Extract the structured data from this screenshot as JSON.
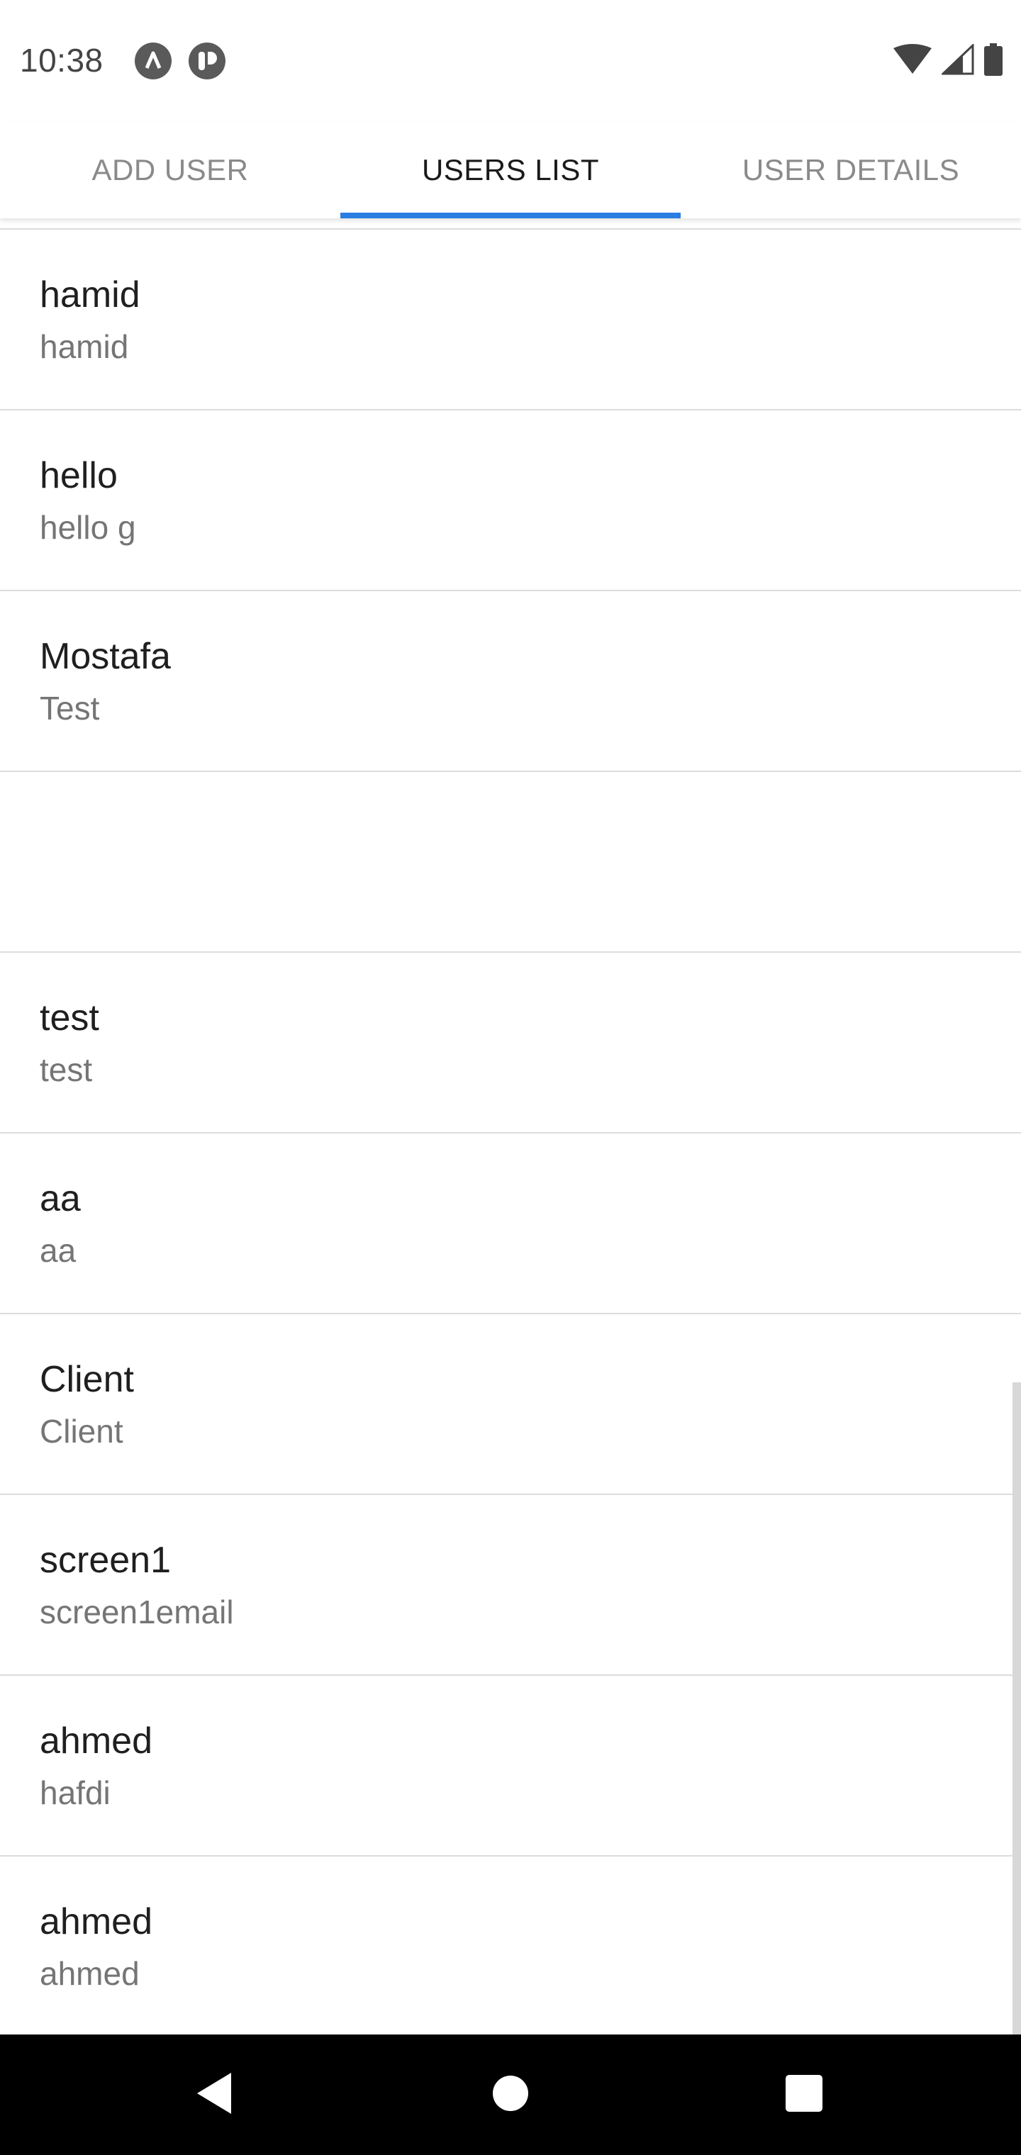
{
  "status_bar": {
    "time": "10:38",
    "icons": [
      "notification-a-icon",
      "notification-b-icon",
      "wifi-icon",
      "signal-icon",
      "battery-icon"
    ]
  },
  "tabs": [
    {
      "label": "ADD USER",
      "active": false
    },
    {
      "label": "USERS LIST",
      "active": true
    },
    {
      "label": "USER DETAILS",
      "active": false
    }
  ],
  "users": [
    {
      "name": "hamid",
      "email": "hamid"
    },
    {
      "name": "hello",
      "email": "hello g"
    },
    {
      "name": "Mostafa",
      "email": "Test"
    },
    {
      "name": "",
      "email": ""
    },
    {
      "name": "test",
      "email": "test"
    },
    {
      "name": "aa",
      "email": "aa"
    },
    {
      "name": "Client",
      "email": "Client"
    },
    {
      "name": "screen1",
      "email": "screen1email"
    },
    {
      "name": "ahmed",
      "email": "hafdi"
    },
    {
      "name": "ahmed",
      "email": "ahmed"
    }
  ],
  "colors": {
    "accent": "#2a7de1",
    "divider": "#dcdcdc",
    "nav_bar": "#000000"
  }
}
